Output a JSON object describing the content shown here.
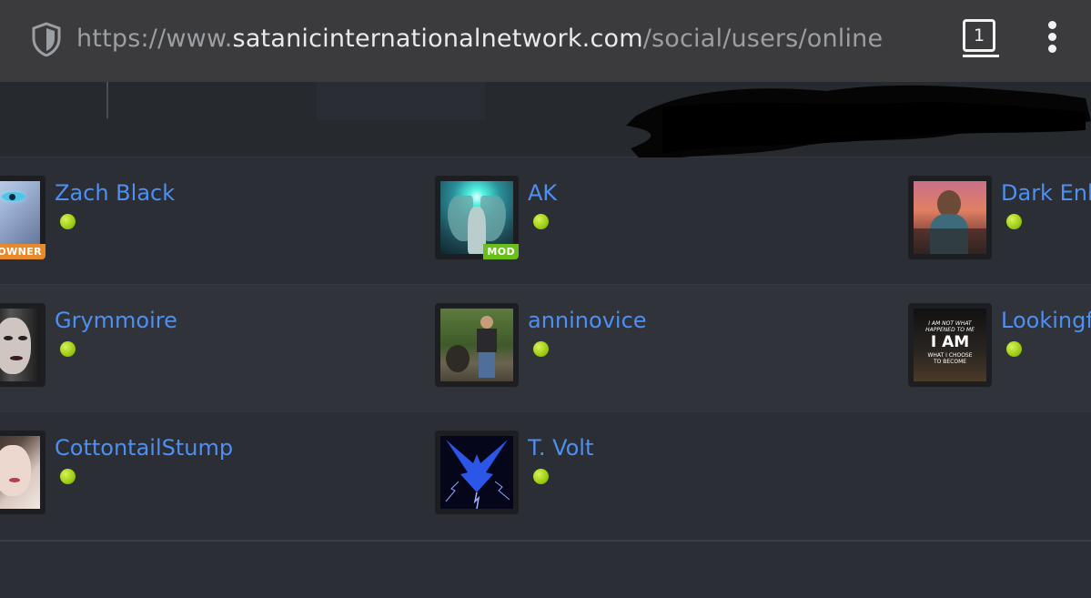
{
  "browser": {
    "url_scheme": "https://www.",
    "url_domain": "satanicinternationalnetwork.com",
    "url_path": "/social/users/online",
    "tab_count": "1"
  },
  "members": [
    {
      "name": "Zach Black",
      "badge": "OWNER",
      "online": true
    },
    {
      "name": "AK",
      "badge": "MOD",
      "online": true
    },
    {
      "name": "Dark Enl",
      "badge": "",
      "online": true
    },
    {
      "name": "Grymmoire",
      "badge": "",
      "online": true
    },
    {
      "name": "anninovice",
      "badge": "",
      "online": true
    },
    {
      "name": "Lookingf",
      "badge": "",
      "online": true
    },
    {
      "name": "CottontailStump",
      "badge": "",
      "online": true
    },
    {
      "name": "T. Volt",
      "badge": "",
      "online": true
    }
  ],
  "avatar_texts": {
    "lookingf": [
      "I AM NOT WHAT",
      "HAPPENED TO ME",
      "I AM",
      "WHAT I CHOOSE",
      "TO BECOME"
    ]
  },
  "colors": {
    "link": "#4d8ff2",
    "online": "#9ccc10",
    "owner_badge": "#e8892a",
    "mod_badge": "#6bbf1a"
  }
}
